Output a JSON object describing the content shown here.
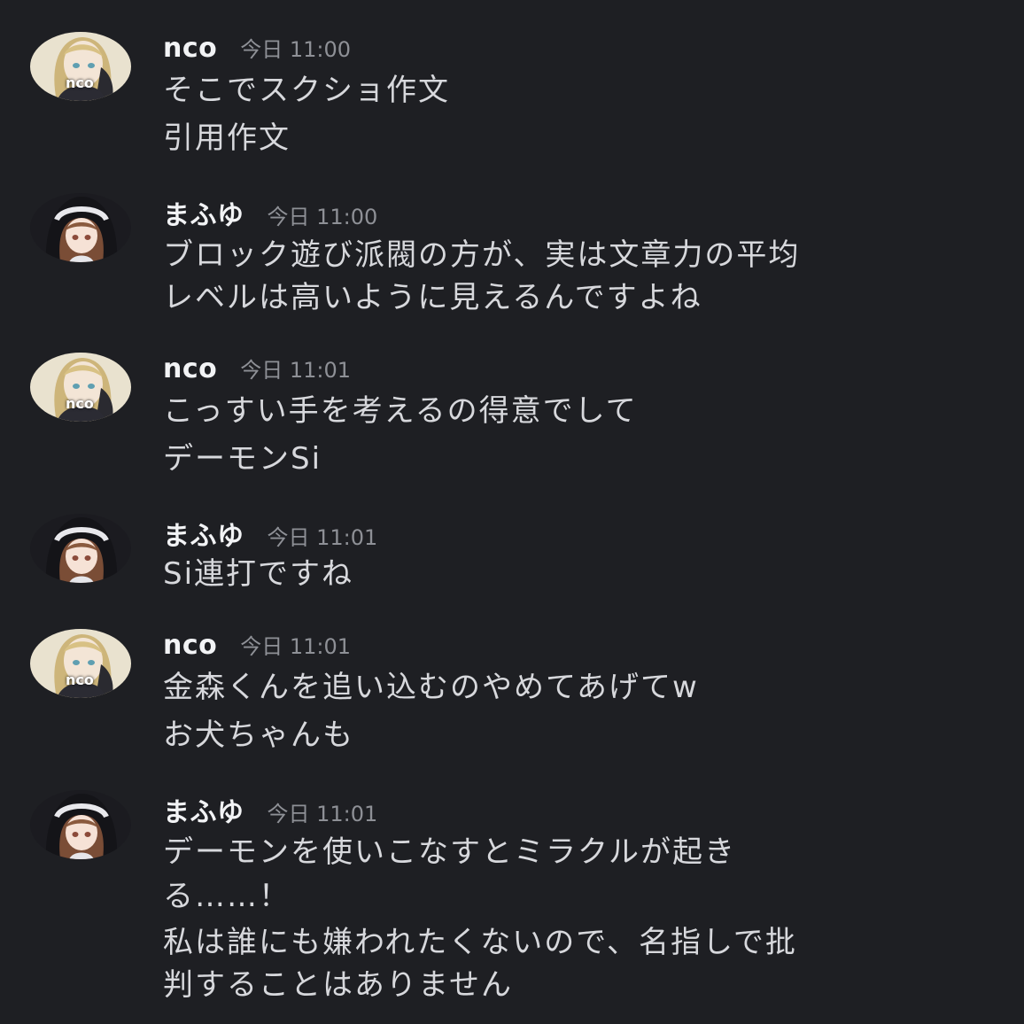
{
  "messages": [
    {
      "author": "nco",
      "avatar": "nco-avatar",
      "avatar_text": "nco",
      "timestamp": "今日 11:00",
      "lines": [
        "そこでスクショ作文",
        "引用作文"
      ]
    },
    {
      "author": "まふゆ",
      "avatar": "mafuyu-avatar",
      "timestamp": "今日 11:00",
      "lines": [
        "ブロック遊び派閥の方が、実は文章力の平均",
        "レベルは高いように見えるんですよね"
      ]
    },
    {
      "author": "nco",
      "avatar": "nco-avatar",
      "avatar_text": "nco",
      "timestamp": "今日 11:01",
      "lines": [
        "こっすい手を考えるの得意でして",
        "デーモンSi"
      ]
    },
    {
      "author": "まふゆ",
      "avatar": "mafuyu-avatar",
      "timestamp": "今日 11:01",
      "lines": [
        "Si連打ですね"
      ]
    },
    {
      "author": "nco",
      "avatar": "nco-avatar",
      "avatar_text": "nco",
      "timestamp": "今日 11:01",
      "lines": [
        "金森くんを追い込むのやめてあげてw",
        "お犬ちゃんも"
      ]
    },
    {
      "author": "まふゆ",
      "avatar": "mafuyu-avatar",
      "timestamp": "今日 11:01",
      "lines": [
        "デーモンを使いこなすとミラクルが起き",
        "る……！",
        "私は誰にも嫌われたくないので、名指しで批",
        "判することはありません"
      ]
    }
  ],
  "colors": {
    "background": "#1e1f23",
    "username": "#f2f3f5",
    "timestamp": "#8e9096",
    "message_text": "#d7d8dc"
  }
}
